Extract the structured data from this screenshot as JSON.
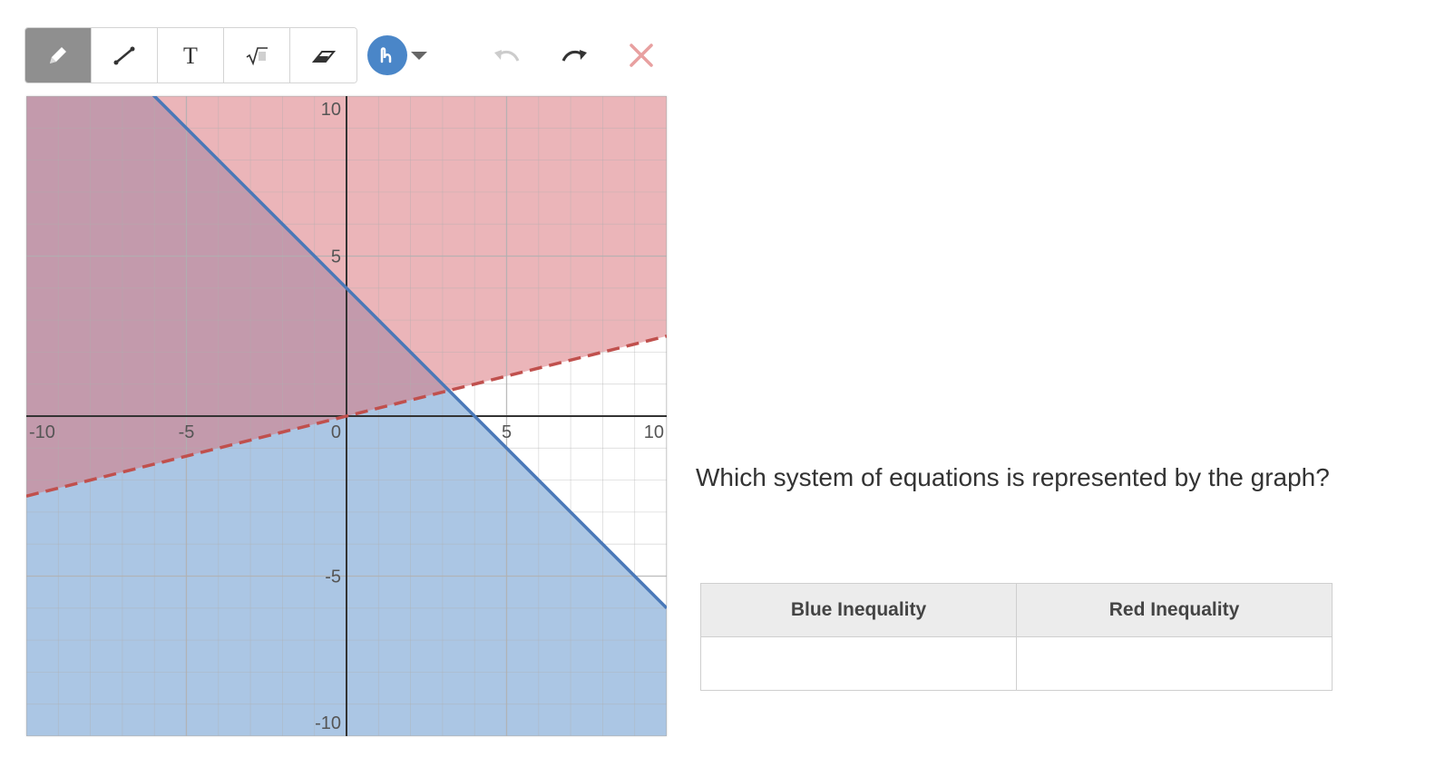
{
  "toolbar": {
    "tools": [
      {
        "name": "pencil",
        "icon": "pencil-icon",
        "active": true
      },
      {
        "name": "line",
        "icon": "line-icon",
        "active": false
      },
      {
        "name": "text",
        "icon": "text-icon",
        "label": "T",
        "active": false
      },
      {
        "name": "math",
        "icon": "sqrt-icon",
        "label": "√",
        "active": false
      },
      {
        "name": "eraser",
        "icon": "eraser-icon",
        "active": false
      }
    ],
    "color_picker": {
      "selected_color": "#4a86c8",
      "icon": "stroke-icon"
    },
    "undo": {
      "icon": "undo-icon",
      "enabled": false
    },
    "redo": {
      "icon": "redo-icon",
      "enabled": true
    },
    "clear": {
      "icon": "close-icon",
      "color": "#e8a0a0"
    }
  },
  "colors": {
    "blue_fill": "#4f88c6",
    "blue_line": "#4a78b8",
    "red_fill": "#d97278",
    "red_line": "#c0504d",
    "grid": "#b0b0b0",
    "axis": "#333333"
  },
  "question": "Which system of equations is represented by the graph?",
  "answer_table": {
    "headers": [
      "Blue Inequality",
      "Red Inequality"
    ],
    "rows": [
      [
        "",
        ""
      ]
    ]
  },
  "chart_data": {
    "type": "line",
    "xlim": [
      -10,
      10
    ],
    "ylim": [
      -10,
      10
    ],
    "grid": true,
    "tick_labels_x": [
      "-10",
      "-5",
      "0",
      "5",
      "10"
    ],
    "tick_labels_y": [
      "10",
      "5",
      "-5",
      "-10"
    ],
    "series": [
      {
        "color": "blue",
        "line": {
          "slope": -1,
          "intercept": 4
        },
        "line_style": "solid",
        "shading": "below"
      },
      {
        "color": "red",
        "line": {
          "slope": 0.25,
          "intercept": 0
        },
        "line_style": "dashed",
        "shading": "above"
      }
    ]
  }
}
